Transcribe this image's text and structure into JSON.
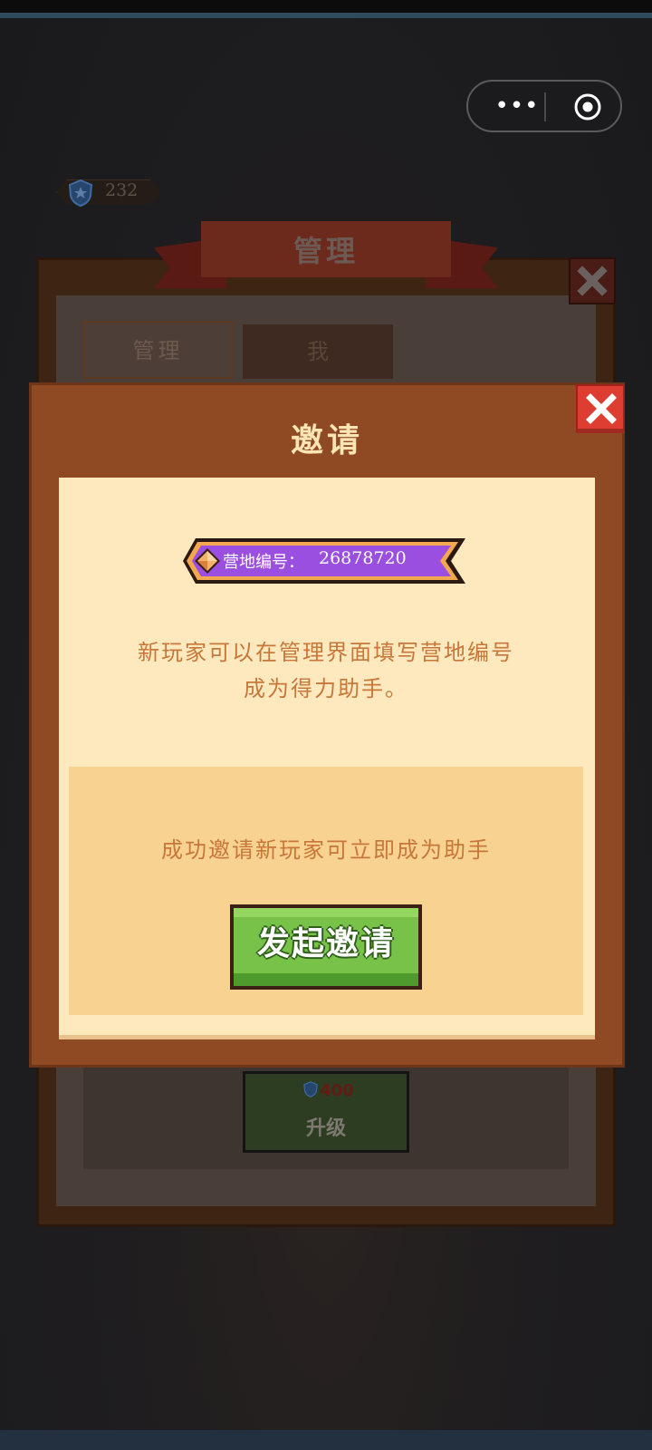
{
  "currency": {
    "value": "232",
    "icon": "shield-star-icon"
  },
  "capsule": {
    "more_label": "•••",
    "icon_more": "more-dots-icon",
    "icon_target": "target-icon"
  },
  "background_panel": {
    "title": "管理",
    "tabs": [
      "管理",
      "我"
    ],
    "upgrade_label": "升级",
    "upgrade_cost": "400"
  },
  "dialog": {
    "title": "邀请",
    "camp_id_label": "营地编号：",
    "camp_id_value": "26878720",
    "description_line1": "新玩家可以在管理界面填写营地编号",
    "description_line2": "成为得力助手。",
    "invite_note": "成功邀请新玩家可立即成为助手",
    "invite_button": "发起邀请"
  },
  "colors": {
    "dialog_frame": "#8f4a23",
    "dialog_body": "#fde9bd",
    "invite_box": "#f8d291",
    "text_accent": "#c7773a",
    "button_green": "#79c24a",
    "close_red": "#de3d32",
    "badge_purple": "#9b4fe0"
  }
}
